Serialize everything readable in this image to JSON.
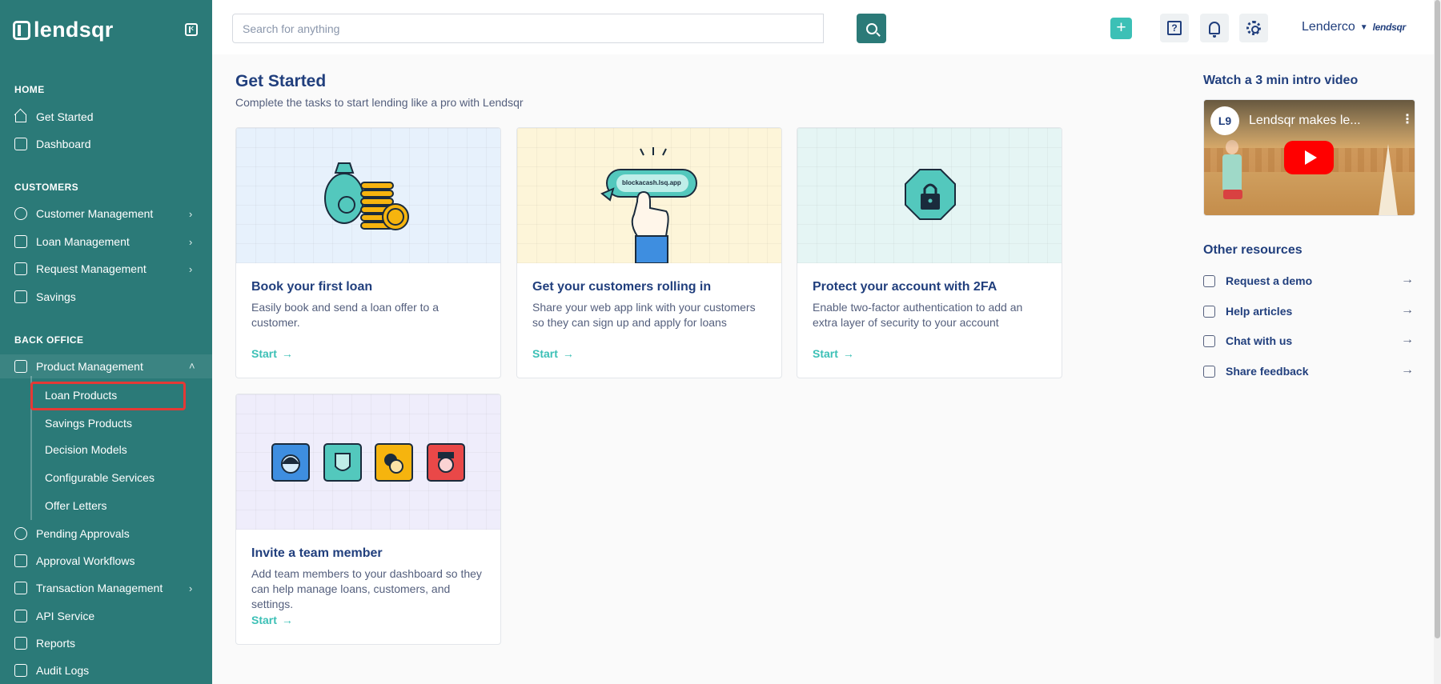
{
  "brand": {
    "name": "lendsqr"
  },
  "sidebar": {
    "sections": [
      "HOME",
      "CUSTOMERS",
      "BACK OFFICE"
    ],
    "home_items": [
      "Get Started",
      "Dashboard"
    ],
    "customer_items": [
      "Customer Management",
      "Loan Management",
      "Request Management",
      "Savings"
    ],
    "back_office_parent": "Product Management",
    "product_sub_items": [
      "Loan Products",
      "Savings Products",
      "Decision Models",
      "Configurable Services",
      "Offer Letters"
    ],
    "other_items": [
      "Pending Approvals",
      "Approval Workflows",
      "Transaction Management",
      "API Service",
      "Reports",
      "Audit Logs"
    ]
  },
  "topbar": {
    "search_placeholder": "Search for anything",
    "add_symbol": "+",
    "help_symbol": "?",
    "user_name": "Lenderco",
    "org_logo": "lendsqr"
  },
  "main": {
    "title": "Get Started",
    "subtitle": "Complete the tasks to start lending like a pro with Lendsqr",
    "cards": [
      {
        "title": "Book your first loan",
        "desc": "Easily book and send a loan offer to a customer.",
        "link": "Start",
        "bg": "#e7f1fc"
      },
      {
        "title": "Get your customers rolling in",
        "desc": "Share your web app link with your customers so they can sign up and apply for loans",
        "link": "Start",
        "bg": "#fdf5d9",
        "illus_text": "blockacash.lsq.app"
      },
      {
        "title": "Protect your account with 2FA",
        "desc": "Enable two-factor authentication to add an extra layer of security to your account",
        "link": "Start",
        "bg": "#e5f5f4"
      },
      {
        "title": "Invite a team member",
        "desc": "Add team members to your dashboard so they can help manage loans, customers, and settings.",
        "link": "Start",
        "bg": "#efedfb"
      }
    ],
    "arrow": "→"
  },
  "right": {
    "video_title": "Watch a 3 min intro video",
    "video_name": "Lendsqr makes le...",
    "video_more": "⋮",
    "channel_mark": "L9",
    "resources_title": "Other resources",
    "resources": [
      "Request a demo",
      "Help articles",
      "Chat with us",
      "Share feedback"
    ]
  },
  "colors": {
    "sidebar": "#2b7a78",
    "accent": "#3cc0b6",
    "text": "#213f7d",
    "highlight": "#e53935"
  }
}
